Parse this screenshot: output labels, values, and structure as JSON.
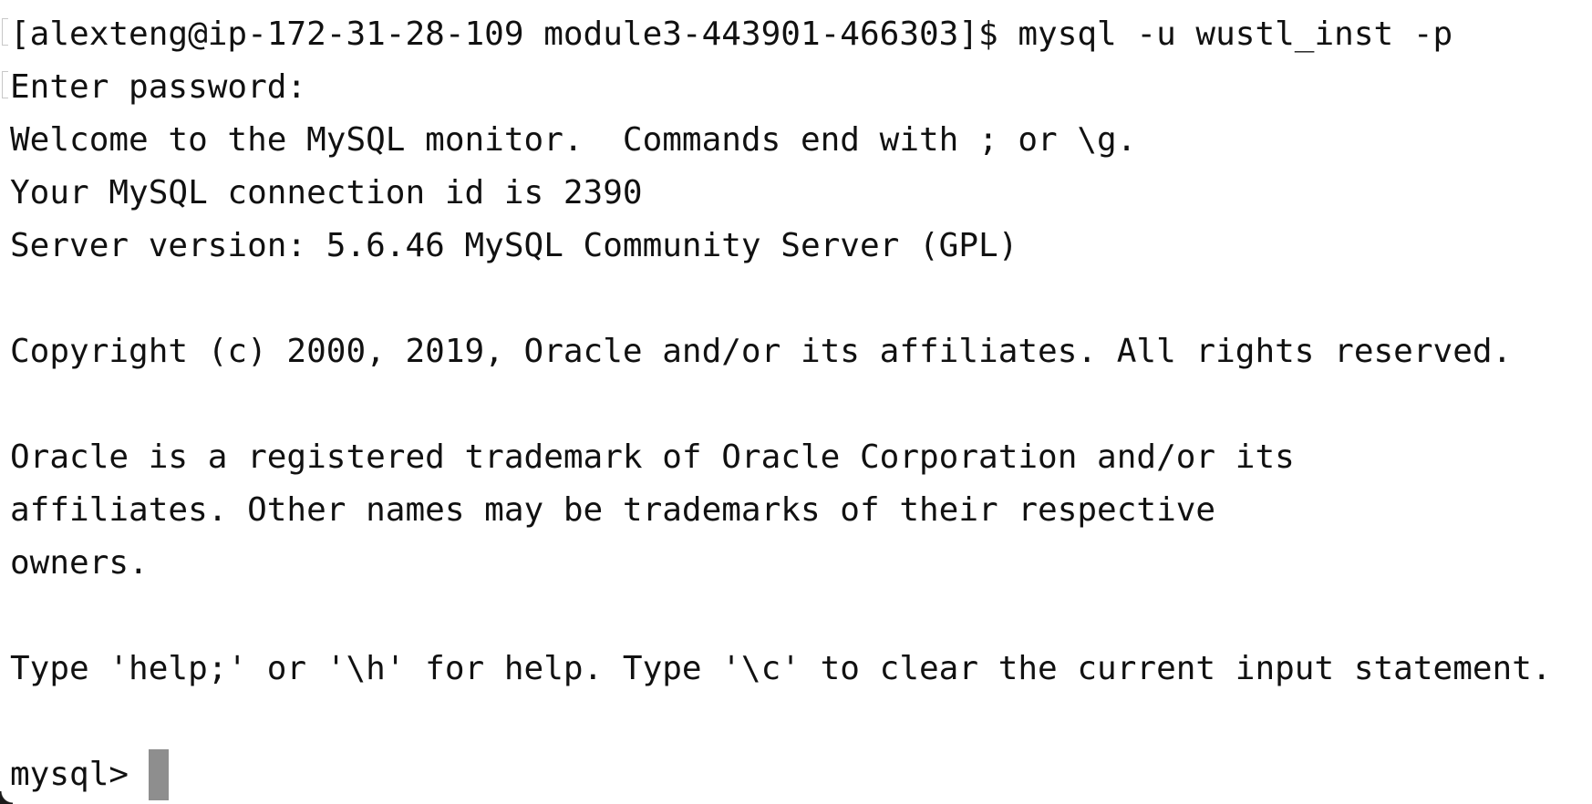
{
  "terminal": {
    "lines": [
      "[alexteng@ip-172-31-28-109 module3-443901-466303]$ mysql -u wustl_inst -p",
      "Enter password:",
      "Welcome to the MySQL monitor.  Commands end with ; or \\g.",
      "Your MySQL connection id is 2390",
      "Server version: 5.6.46 MySQL Community Server (GPL)",
      "",
      "Copyright (c) 2000, 2019, Oracle and/or its affiliates. All rights reserved.",
      "",
      "Oracle is a registered trademark of Oracle Corporation and/or its",
      "affiliates. Other names may be trademarks of their respective",
      "owners.",
      "",
      "Type 'help;' or '\\h' for help. Type '\\c' to clear the current input statement.",
      ""
    ],
    "prompt": "mysql>"
  }
}
